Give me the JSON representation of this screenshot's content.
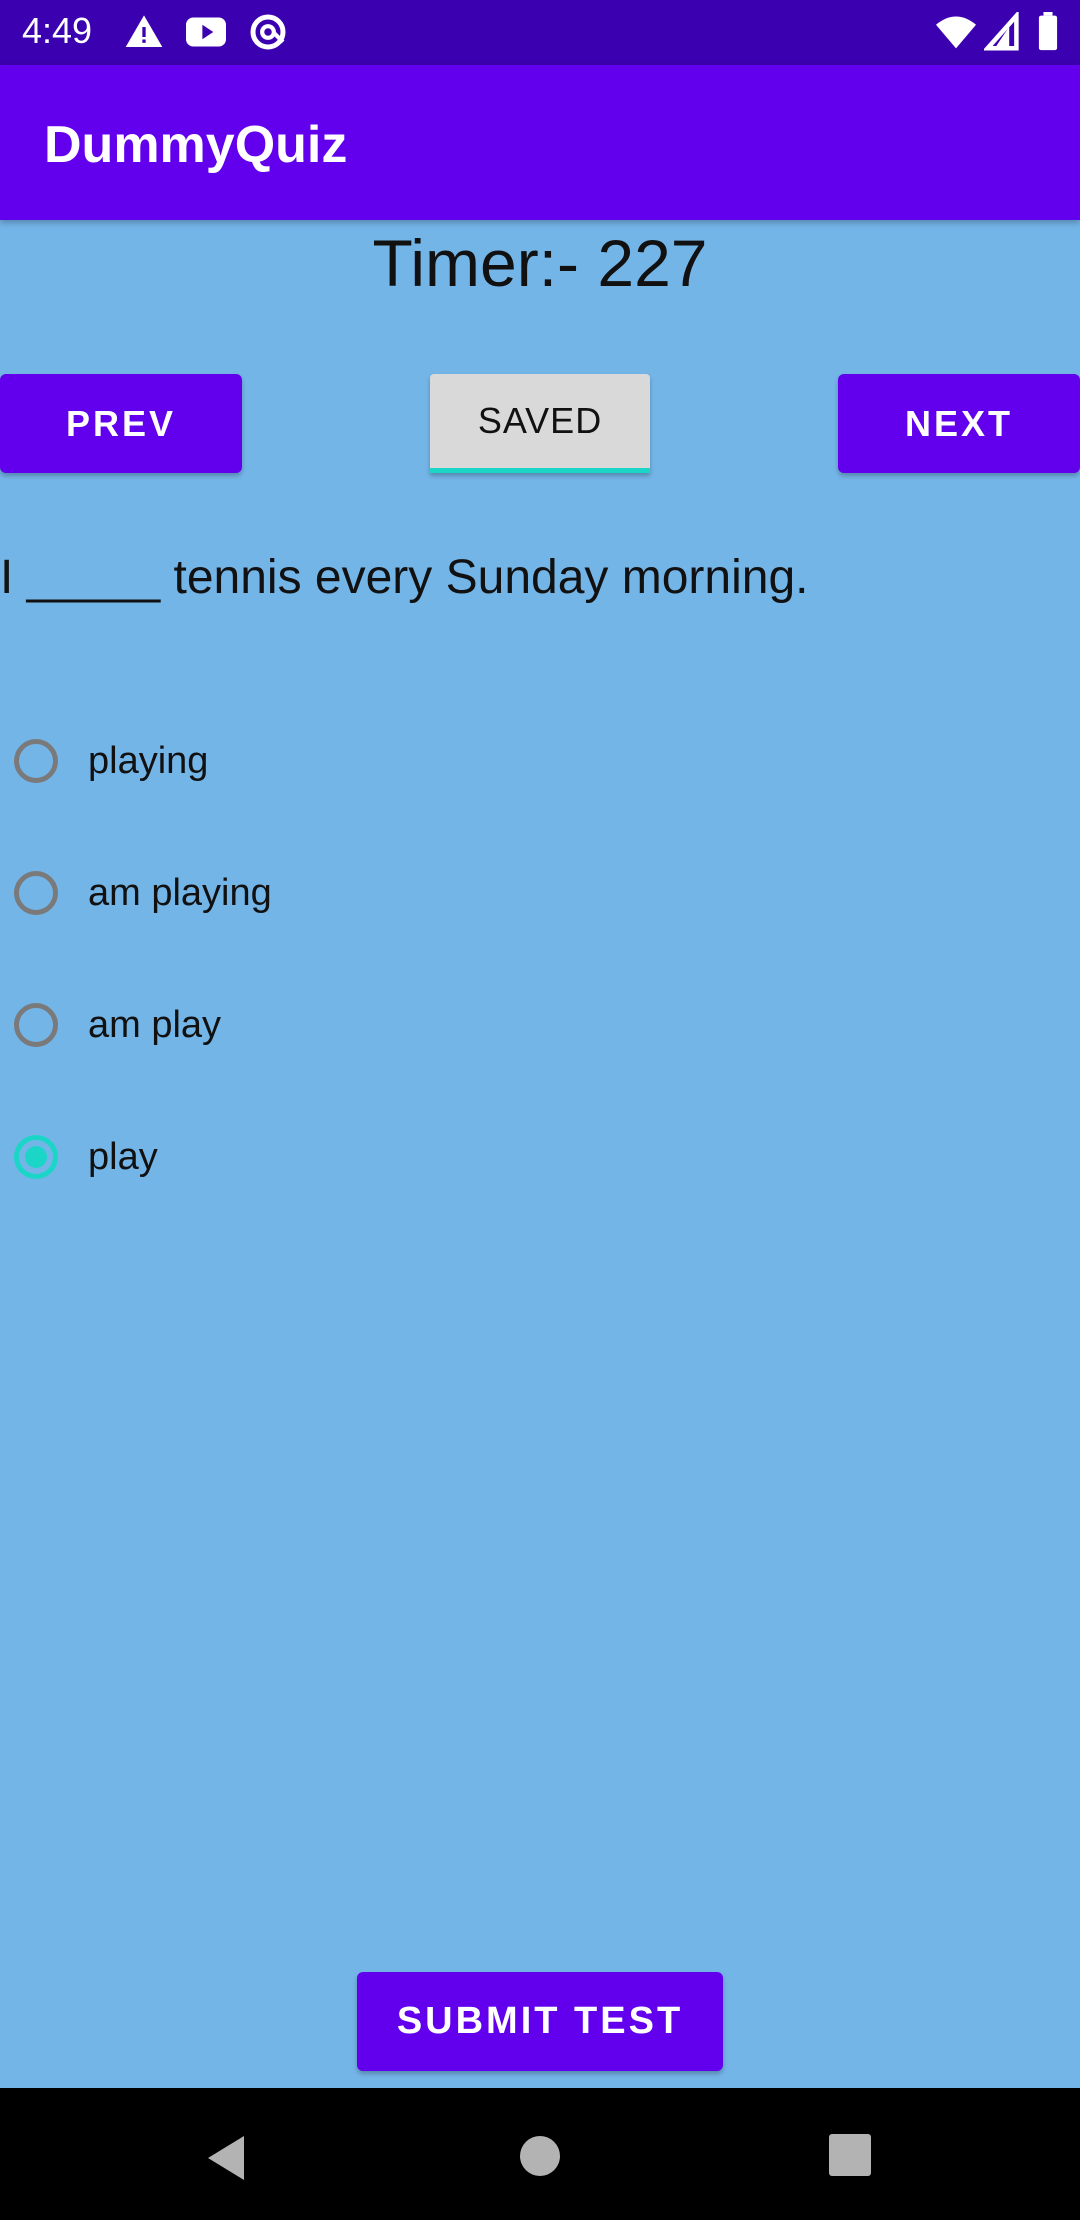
{
  "status_bar": {
    "time": "4:49",
    "left_icons": [
      "warning-icon",
      "youtube-icon",
      "at-sign-icon"
    ],
    "right_icons": [
      "wifi-icon",
      "cellular-icon",
      "battery-icon"
    ]
  },
  "app_bar": {
    "title": "DummyQuiz"
  },
  "timer": {
    "text": "Timer:- 227"
  },
  "controls": {
    "prev_label": "PREV",
    "saved_label": "SAVED",
    "next_label": "NEXT"
  },
  "question": {
    "text": "I _____ tennis every Sunday morning.",
    "options": [
      {
        "label": "playing",
        "selected": false
      },
      {
        "label": "am playing",
        "selected": false
      },
      {
        "label": "am play",
        "selected": false
      },
      {
        "label": "play",
        "selected": true
      }
    ]
  },
  "submit": {
    "label": "SUBMIT TEST"
  },
  "nav_bar": {
    "icons": [
      "back-icon",
      "home-icon",
      "recents-icon"
    ]
  },
  "colors": {
    "primary": "#6200ee",
    "status_bar": "#3b00b0",
    "background": "#74b5e8",
    "accent": "#1bd6c6"
  }
}
